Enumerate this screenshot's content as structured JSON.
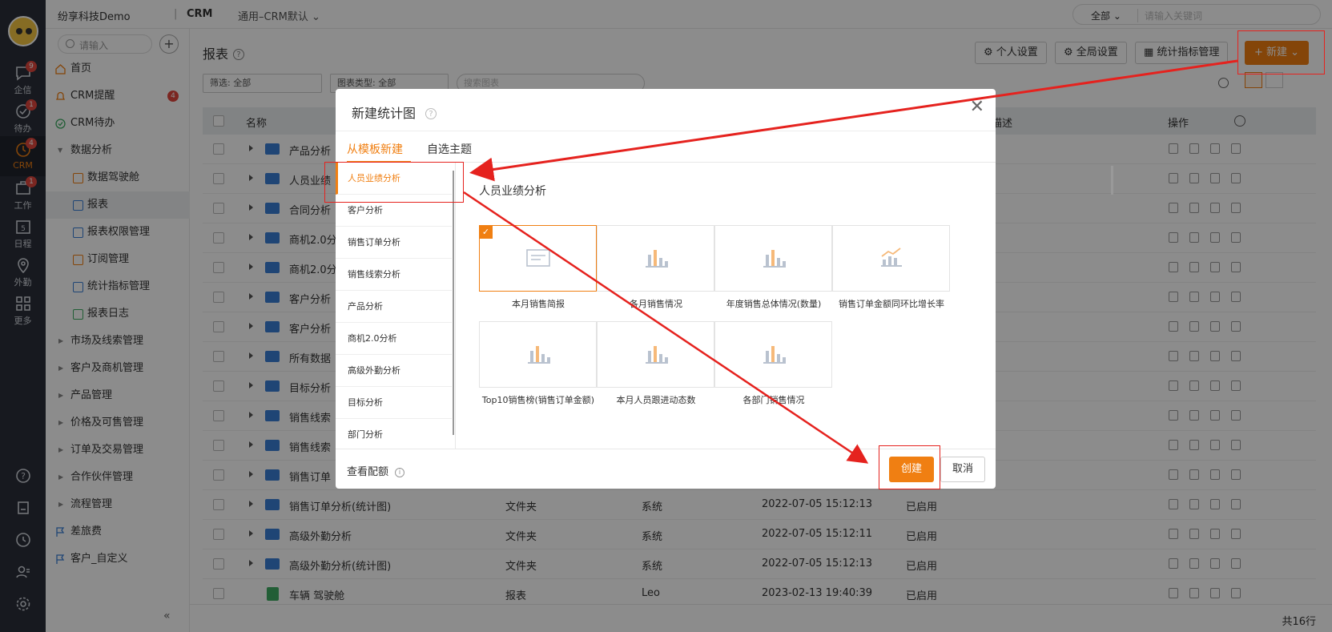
{
  "topbar": {
    "company": "纷享科技Demo",
    "separator": "|",
    "app": "CRM",
    "view": "通用–CRM默认",
    "search_scope": "全部",
    "search_placeholder": "请输入关键词"
  },
  "rail": {
    "items": [
      {
        "label": "企信",
        "badge": "9"
      },
      {
        "label": "待办",
        "badge": "1"
      },
      {
        "label": "CRM",
        "badge": "4"
      },
      {
        "label": "工作",
        "badge": "1"
      },
      {
        "label": "日程",
        "day": "5"
      },
      {
        "label": "外勤"
      },
      {
        "label": "更多"
      }
    ]
  },
  "leftnav": {
    "search_placeholder": "请输入",
    "items": [
      {
        "label": "首页"
      },
      {
        "label": "CRM提醒",
        "badge": "4"
      },
      {
        "label": "CRM待办"
      },
      {
        "label": "数据分析"
      },
      {
        "label": "数据驾驶舱"
      },
      {
        "label": "报表"
      },
      {
        "label": "报表权限管理"
      },
      {
        "label": "订阅管理"
      },
      {
        "label": "统计指标管理"
      },
      {
        "label": "报表日志"
      },
      {
        "label": "市场及线索管理"
      },
      {
        "label": "客户及商机管理"
      },
      {
        "label": "产品管理"
      },
      {
        "label": "价格及可售管理"
      },
      {
        "label": "订单及交易管理"
      },
      {
        "label": "合作伙伴管理"
      },
      {
        "label": "流程管理"
      },
      {
        "label": "差旅费"
      },
      {
        "label": "客户_自定义"
      }
    ],
    "collapse": "«"
  },
  "main": {
    "title": "报表",
    "personal_settings": "个人设置",
    "global_settings": "全局设置",
    "metric_mgmt": "统计指标管理",
    "new_button": "+ 新建",
    "filter1": "筛选: 全部",
    "filter2": "图表类型: 全部",
    "search_placeholder": "搜索图表",
    "columns": {
      "name": "名称",
      "desc": "描述",
      "ops": "操作"
    },
    "rows": [
      {
        "name": "产品分析"
      },
      {
        "name": "人员业绩"
      },
      {
        "name": "合同分析"
      },
      {
        "name": "商机2.0分"
      },
      {
        "name": "商机2.0分"
      },
      {
        "name": "客户分析"
      },
      {
        "name": "客户分析"
      },
      {
        "name": "所有数据"
      },
      {
        "name": "目标分析"
      },
      {
        "name": "销售线索"
      },
      {
        "name": "销售线索"
      },
      {
        "name": "销售订单"
      },
      {
        "name": "销售订单分析(统计图)",
        "type": "文件夹",
        "creator": "系统",
        "time": "2022-07-05 15:12:13",
        "status": "已启用"
      },
      {
        "name": "高级外勤分析",
        "type": "文件夹",
        "creator": "系统",
        "time": "2022-07-05 15:12:11",
        "status": "已启用"
      },
      {
        "name": "高级外勤分析(统计图)",
        "type": "文件夹",
        "creator": "系统",
        "time": "2022-07-05 15:12:13",
        "status": "已启用"
      },
      {
        "name": "车辆 驾驶舱",
        "type": "报表",
        "creator": "Leo",
        "time": "2023-02-13 19:40:39",
        "status": "已启用"
      }
    ],
    "total": "共16行"
  },
  "modal": {
    "title": "新建统计图",
    "tab_template": "从模板新建",
    "tab_custom": "自选主题",
    "categories": [
      "人员业绩分析",
      "客户分析",
      "销售订单分析",
      "销售线索分析",
      "产品分析",
      "商机2.0分析",
      "高级外勤分析",
      "目标分析",
      "部门分析"
    ],
    "section_title": "人员业绩分析",
    "templates": [
      "本月销售简报",
      "各月销售情况",
      "年度销售总体情况(数量)",
      "销售订单金额同环比增长率",
      "Top10销售榜(销售订单金额)",
      "本月人员跟进动态数",
      "各部门销售情况"
    ],
    "view_config": "查看配额",
    "create": "创建",
    "cancel": "取消"
  },
  "colors": {
    "accent": "#f07f12",
    "annotation": "#e5221e",
    "rail": "#2a2f3a"
  }
}
